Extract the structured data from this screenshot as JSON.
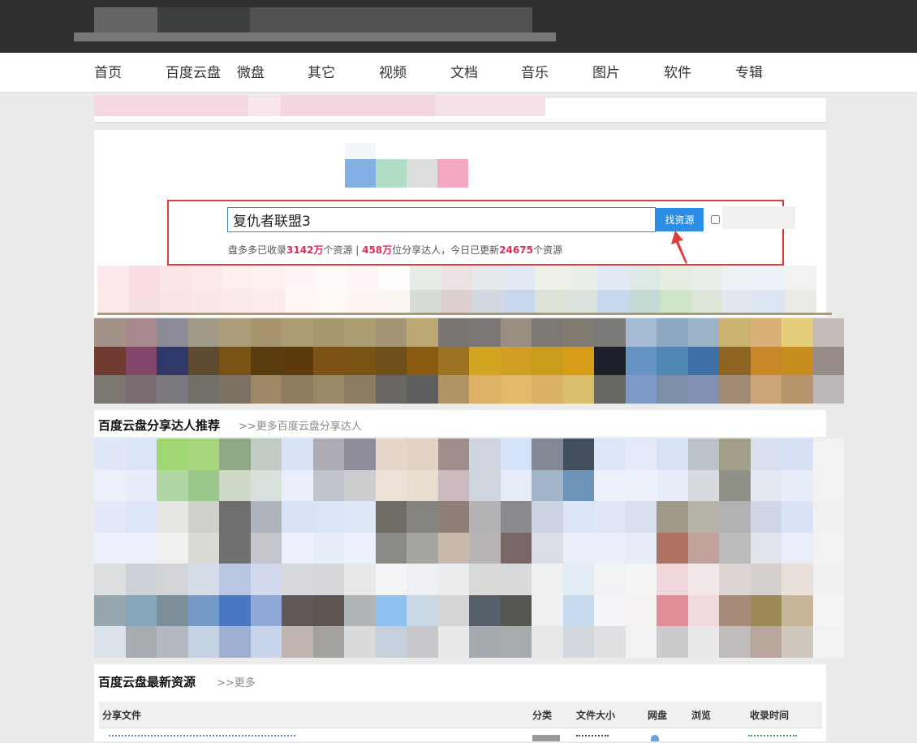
{
  "nav": {
    "items": [
      {
        "label": "首页"
      },
      {
        "label": "百度云盘"
      },
      {
        "label": "微盘"
      },
      {
        "label": "其它"
      },
      {
        "label": "视频"
      },
      {
        "label": "文档"
      },
      {
        "label": "音乐"
      },
      {
        "label": "图片"
      },
      {
        "label": "软件"
      },
      {
        "label": "专辑"
      }
    ]
  },
  "search": {
    "value": "复仇者联盟3",
    "button_label": "找资源",
    "stats": {
      "prefix": "盘多多已收录",
      "count1": "3142万",
      "mid1": "个资源 | ",
      "count2": "458万",
      "mid2": "位分享达人，今日已更新",
      "count3": "24675",
      "suffix": "个资源"
    }
  },
  "sections": {
    "recommend_title": "百度云盘分享达人推荐",
    "recommend_more": ">>更多百度云盘分享达人",
    "latest_title": "百度云盘最新资源",
    "latest_more": ">>更多"
  },
  "table": {
    "headers": [
      "分享文件",
      "分类",
      "文件大小",
      "网盘",
      "浏览",
      "收录时间"
    ]
  },
  "colors": {
    "accent": "#2d8ce3",
    "highlight": "#e02a5b",
    "annotation": "#e03c3c"
  }
}
